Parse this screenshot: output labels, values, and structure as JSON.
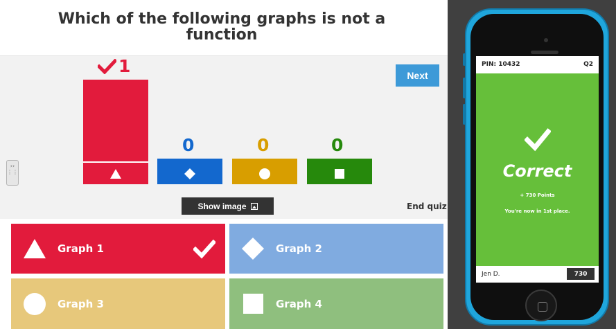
{
  "question": {
    "title": "Which of the following graphs is not a function"
  },
  "controls": {
    "next_label": "Next",
    "show_image_label": "Show image",
    "end_quiz_label": "End quiz"
  },
  "results": {
    "bars": [
      {
        "count": "1",
        "value": 1,
        "shape": "triangle-icon",
        "color": "#e21b3c",
        "correct": true
      },
      {
        "count": "0",
        "value": 0,
        "shape": "diamond-icon",
        "color": "#1368ce",
        "correct": false
      },
      {
        "count": "0",
        "value": 0,
        "shape": "circle-icon",
        "color": "#d89e00",
        "correct": false
      },
      {
        "count": "0",
        "value": 0,
        "shape": "square-icon",
        "color": "#26890c",
        "correct": false
      }
    ]
  },
  "answers": [
    {
      "label": "Graph 1",
      "shape": "triangle-icon",
      "color": "#e21b3c",
      "correct": true
    },
    {
      "label": "Graph 2",
      "shape": "diamond-icon",
      "color": "#80abe0",
      "correct": false
    },
    {
      "label": "Graph 3",
      "shape": "circle-icon",
      "color": "#e7c87b",
      "correct": false
    },
    {
      "label": "Graph 4",
      "shape": "square-icon",
      "color": "#8fbf7e",
      "correct": false
    }
  ],
  "player": {
    "pin": "PIN: 10432",
    "question_number": "Q2",
    "result": "Correct",
    "points": "+ 730 Points",
    "place": "You're now in 1st place.",
    "name": "Jen D.",
    "score": "730",
    "result_color": "#66bf3a"
  }
}
